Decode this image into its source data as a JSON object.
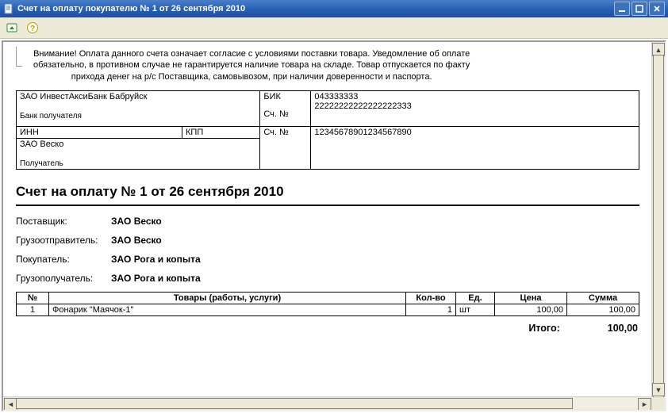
{
  "window": {
    "title": "Счет на оплату покупателю № 1 от 26 сентября 2010"
  },
  "notice": {
    "pre": "Внимание! Оплата данного счета означает согласие с условиями поставки товара. Уведомление об оплате",
    "mid": "обязательно, в противном случае не гарантируется наличие товара на складе. Товар отпускается по факту",
    "post": "прихода денег на р/с Поставщика, самовывозом, при наличии доверенности и паспорта."
  },
  "bank": {
    "payee_bank": "ЗАО ИнвестАксиБанк Бабруйск",
    "payee_bank_label": "Банк получателя",
    "bik_label": "БИК",
    "bik_value": "043333333",
    "corr_label": "Сч. №",
    "corr_value": "22222222222222222333",
    "inn_label": "ИНН",
    "kpp_label": "КПП",
    "payee_name": "ЗАО Веско",
    "payee_label": "Получатель",
    "acct_label": "Сч. №",
    "acct_value": "12345678901234567890"
  },
  "invoice": {
    "title": "Счет на оплату № 1 от 26 сентября 2010",
    "supplier_label": "Поставщик:",
    "supplier_value": "ЗАО Веско",
    "consignor_label": "Грузоотправитель:",
    "consignor_value": "ЗАО Веско",
    "buyer_label": "Покупатель:",
    "buyer_value": "ЗАО Рога и копыта",
    "consignee_label": "Грузополучатель:",
    "consignee_value": "ЗАО Рога и копыта"
  },
  "items_header": {
    "num": "№",
    "name": "Товары (работы, услуги)",
    "qty": "Кол-во",
    "unit": "Ед.",
    "price": "Цена",
    "sum": "Сумма"
  },
  "items": [
    {
      "num": "1",
      "name": "Фонарик \"Маячок-1\"",
      "qty": "1",
      "unit": "шт",
      "price": "100,00",
      "sum": "100,00"
    }
  ],
  "totals": {
    "label": "Итого:",
    "value": "100,00"
  }
}
